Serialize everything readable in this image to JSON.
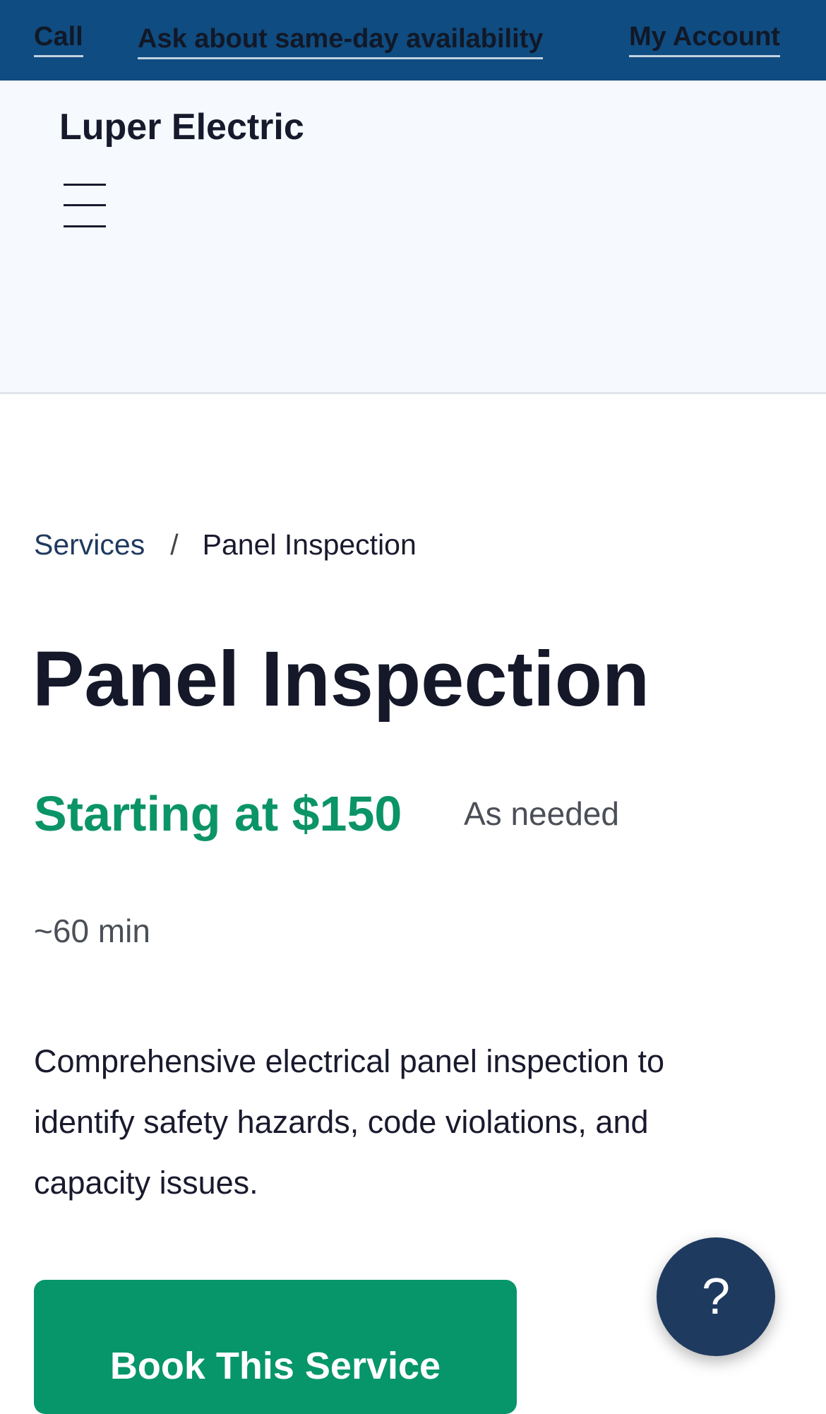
{
  "topbar": {
    "call_label": "Call",
    "sameday_label": "Ask about same-day availability",
    "account_label": "My Account"
  },
  "header": {
    "logo": "Luper Electric",
    "menu_icon": "hamburger-menu-icon"
  },
  "breadcrumb": {
    "parent": "Services",
    "separator": "/",
    "current": "Panel Inspection"
  },
  "service": {
    "title": "Panel Inspection",
    "price": "Starting at $150",
    "frequency": "As needed",
    "duration": "~60 min",
    "description": "Comprehensive electrical panel inspection to identify safety hazards, code violations, and capacity issues.",
    "book_label": "Book This Service"
  },
  "help": {
    "label": "?",
    "icon": "question-mark-icon"
  },
  "colors": {
    "topbar": "#0f4c81",
    "accent_green": "#069669",
    "help_button": "#1f3a5f"
  }
}
